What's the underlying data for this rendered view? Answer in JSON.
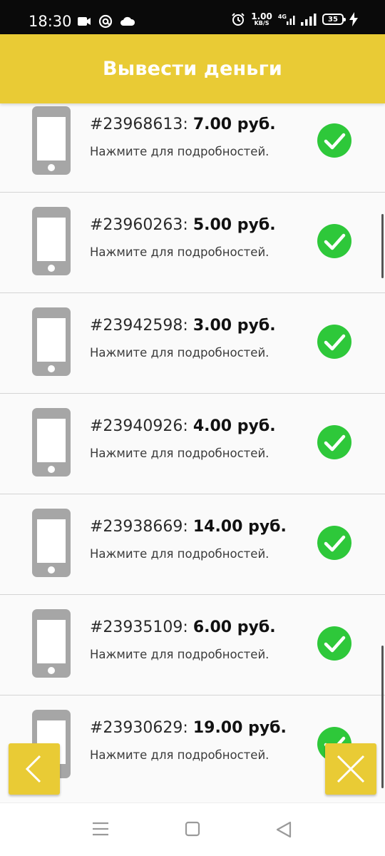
{
  "status_bar": {
    "time": "18:30",
    "net_speed_value": "1.00",
    "net_speed_unit": "KB/S",
    "network_type": "4G",
    "battery_level": "35"
  },
  "header": {
    "title": "Вывести деньги"
  },
  "withdrawals": [
    {
      "id": "#23968613:",
      "amount": "7.00 руб.",
      "hint": "Нажмите для подробностей.",
      "status": "completed"
    },
    {
      "id": "#23960263:",
      "amount": "5.00 руб.",
      "hint": "Нажмите для подробностей.",
      "status": "completed"
    },
    {
      "id": "#23942598:",
      "amount": "3.00 руб.",
      "hint": "Нажмите для подробностей.",
      "status": "completed"
    },
    {
      "id": "#23940926:",
      "amount": "4.00 руб.",
      "hint": "Нажмите для подробностей.",
      "status": "completed"
    },
    {
      "id": "#23938669:",
      "amount": "14.00 руб.",
      "hint": "Нажмите для подробностей.",
      "status": "completed"
    },
    {
      "id": "#23935109:",
      "amount": "6.00 руб.",
      "hint": "Нажмите для подробностей.",
      "status": "completed"
    },
    {
      "id": "#23930629:",
      "amount": "19.00 руб.",
      "hint": "Нажмите для подробностей.",
      "status": "completed"
    }
  ],
  "colors": {
    "accent": "#e9cb35",
    "success": "#2ec83a",
    "phone_icon": "#a6a6a6"
  },
  "icons": {
    "row_icon": "smartphone-icon",
    "status_icon": "check-circle-icon",
    "back_button": "chevron-left-icon",
    "close_button": "close-icon"
  }
}
